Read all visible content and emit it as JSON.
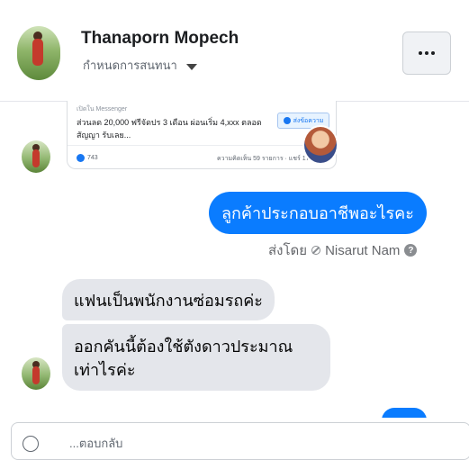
{
  "header": {
    "name": "Thanaporn Mopech",
    "status": "กำหนดการสนทนา"
  },
  "ad": {
    "label": "เปิดใน Messenger",
    "text": "ส่วนลด 20,000 ฟรีจัดปร 3 เดือน ผ่อนเริ่ม 4,xxx ตลอดสัญญา รับเลย...",
    "button": "ส่งข้อความ",
    "likes": "743",
    "stats": "ความคิดเห็น 59 รายการ · แชร์ 17 ครั้ง"
  },
  "messages": {
    "outgoing": "ลูกค้าประกอบอาชีพอะไรคะ",
    "sent_by_prefix": "ส่งโดย",
    "sent_by_name": "Nisarut Nam",
    "incoming_1": "แฟนเป็นพนักงานซ่อมรถค่ะ",
    "incoming_2_line1": "ออกคันนี้ต้องใช้ตังดาวประมาณ",
    "incoming_2_line2": "เท่าไรค่ะ"
  },
  "composer": {
    "text": "...ตอบกลับ"
  },
  "colors": {
    "accent": "#0a7cff",
    "incoming_bubble": "#e4e6eb"
  }
}
